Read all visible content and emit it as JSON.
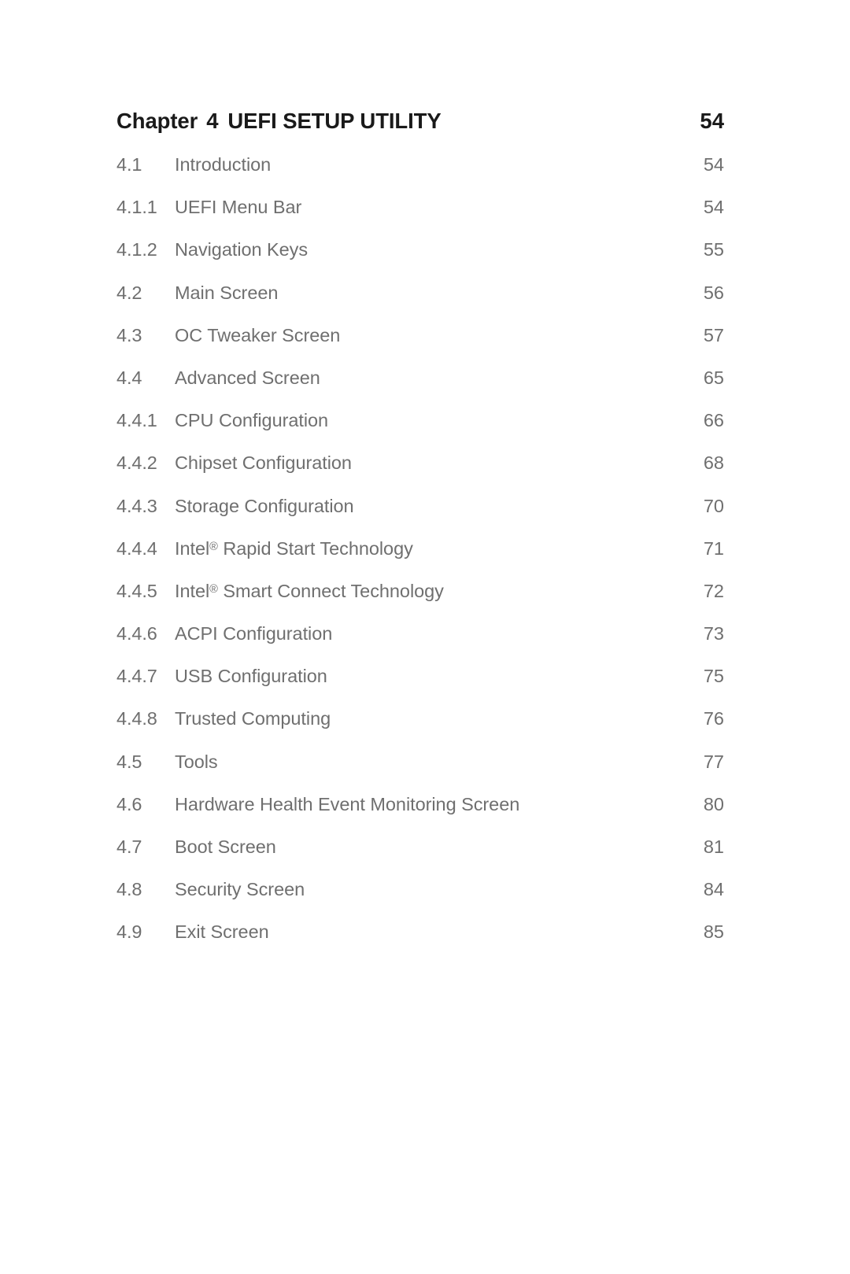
{
  "chapter": {
    "label": "Chapter",
    "number": "4",
    "title": "UEFI SETUP UTILITY",
    "page": "54"
  },
  "entries": [
    {
      "num": "4.1",
      "title": "Introduction",
      "page": "54"
    },
    {
      "num": "4.1.1",
      "title": "UEFI Menu Bar",
      "page": "54"
    },
    {
      "num": "4.1.2",
      "title": "Navigation Keys",
      "page": "55"
    },
    {
      "num": "4.2",
      "title": "Main Screen",
      "page": "56"
    },
    {
      "num": "4.3",
      "title": "OC Tweaker Screen",
      "page": "57"
    },
    {
      "num": "4.4",
      "title": "Advanced Screen",
      "page": "65"
    },
    {
      "num": "4.4.1",
      "title": "CPU Configuration",
      "page": "66"
    },
    {
      "num": "4.4.2",
      "title": "Chipset Configuration",
      "page": "68"
    },
    {
      "num": "4.4.3",
      "title": "Storage Configuration",
      "page": "70"
    },
    {
      "num": "4.4.4",
      "title": "Intel® Rapid Start Technology",
      "page": "71"
    },
    {
      "num": "4.4.5",
      "title": "Intel® Smart Connect Technology",
      "page": "72"
    },
    {
      "num": "4.4.6",
      "title": "ACPI Configuration",
      "page": "73"
    },
    {
      "num": "4.4.7",
      "title": "USB Configuration",
      "page": "75"
    },
    {
      "num": "4.4.8",
      "title": "Trusted Computing",
      "page": "76"
    },
    {
      "num": "4.5",
      "title": "Tools",
      "page": "77"
    },
    {
      "num": "4.6",
      "title": "Hardware Health Event Monitoring Screen",
      "page": "80"
    },
    {
      "num": "4.7",
      "title": "Boot Screen",
      "page": "81"
    },
    {
      "num": "4.8",
      "title": "Security Screen",
      "page": "84"
    },
    {
      "num": "4.9",
      "title": "Exit Screen",
      "page": "85"
    }
  ],
  "colors": {
    "page_background": "#ffffff",
    "heading_text": "#1a1a1a",
    "entry_text": "#6f6f6f"
  }
}
